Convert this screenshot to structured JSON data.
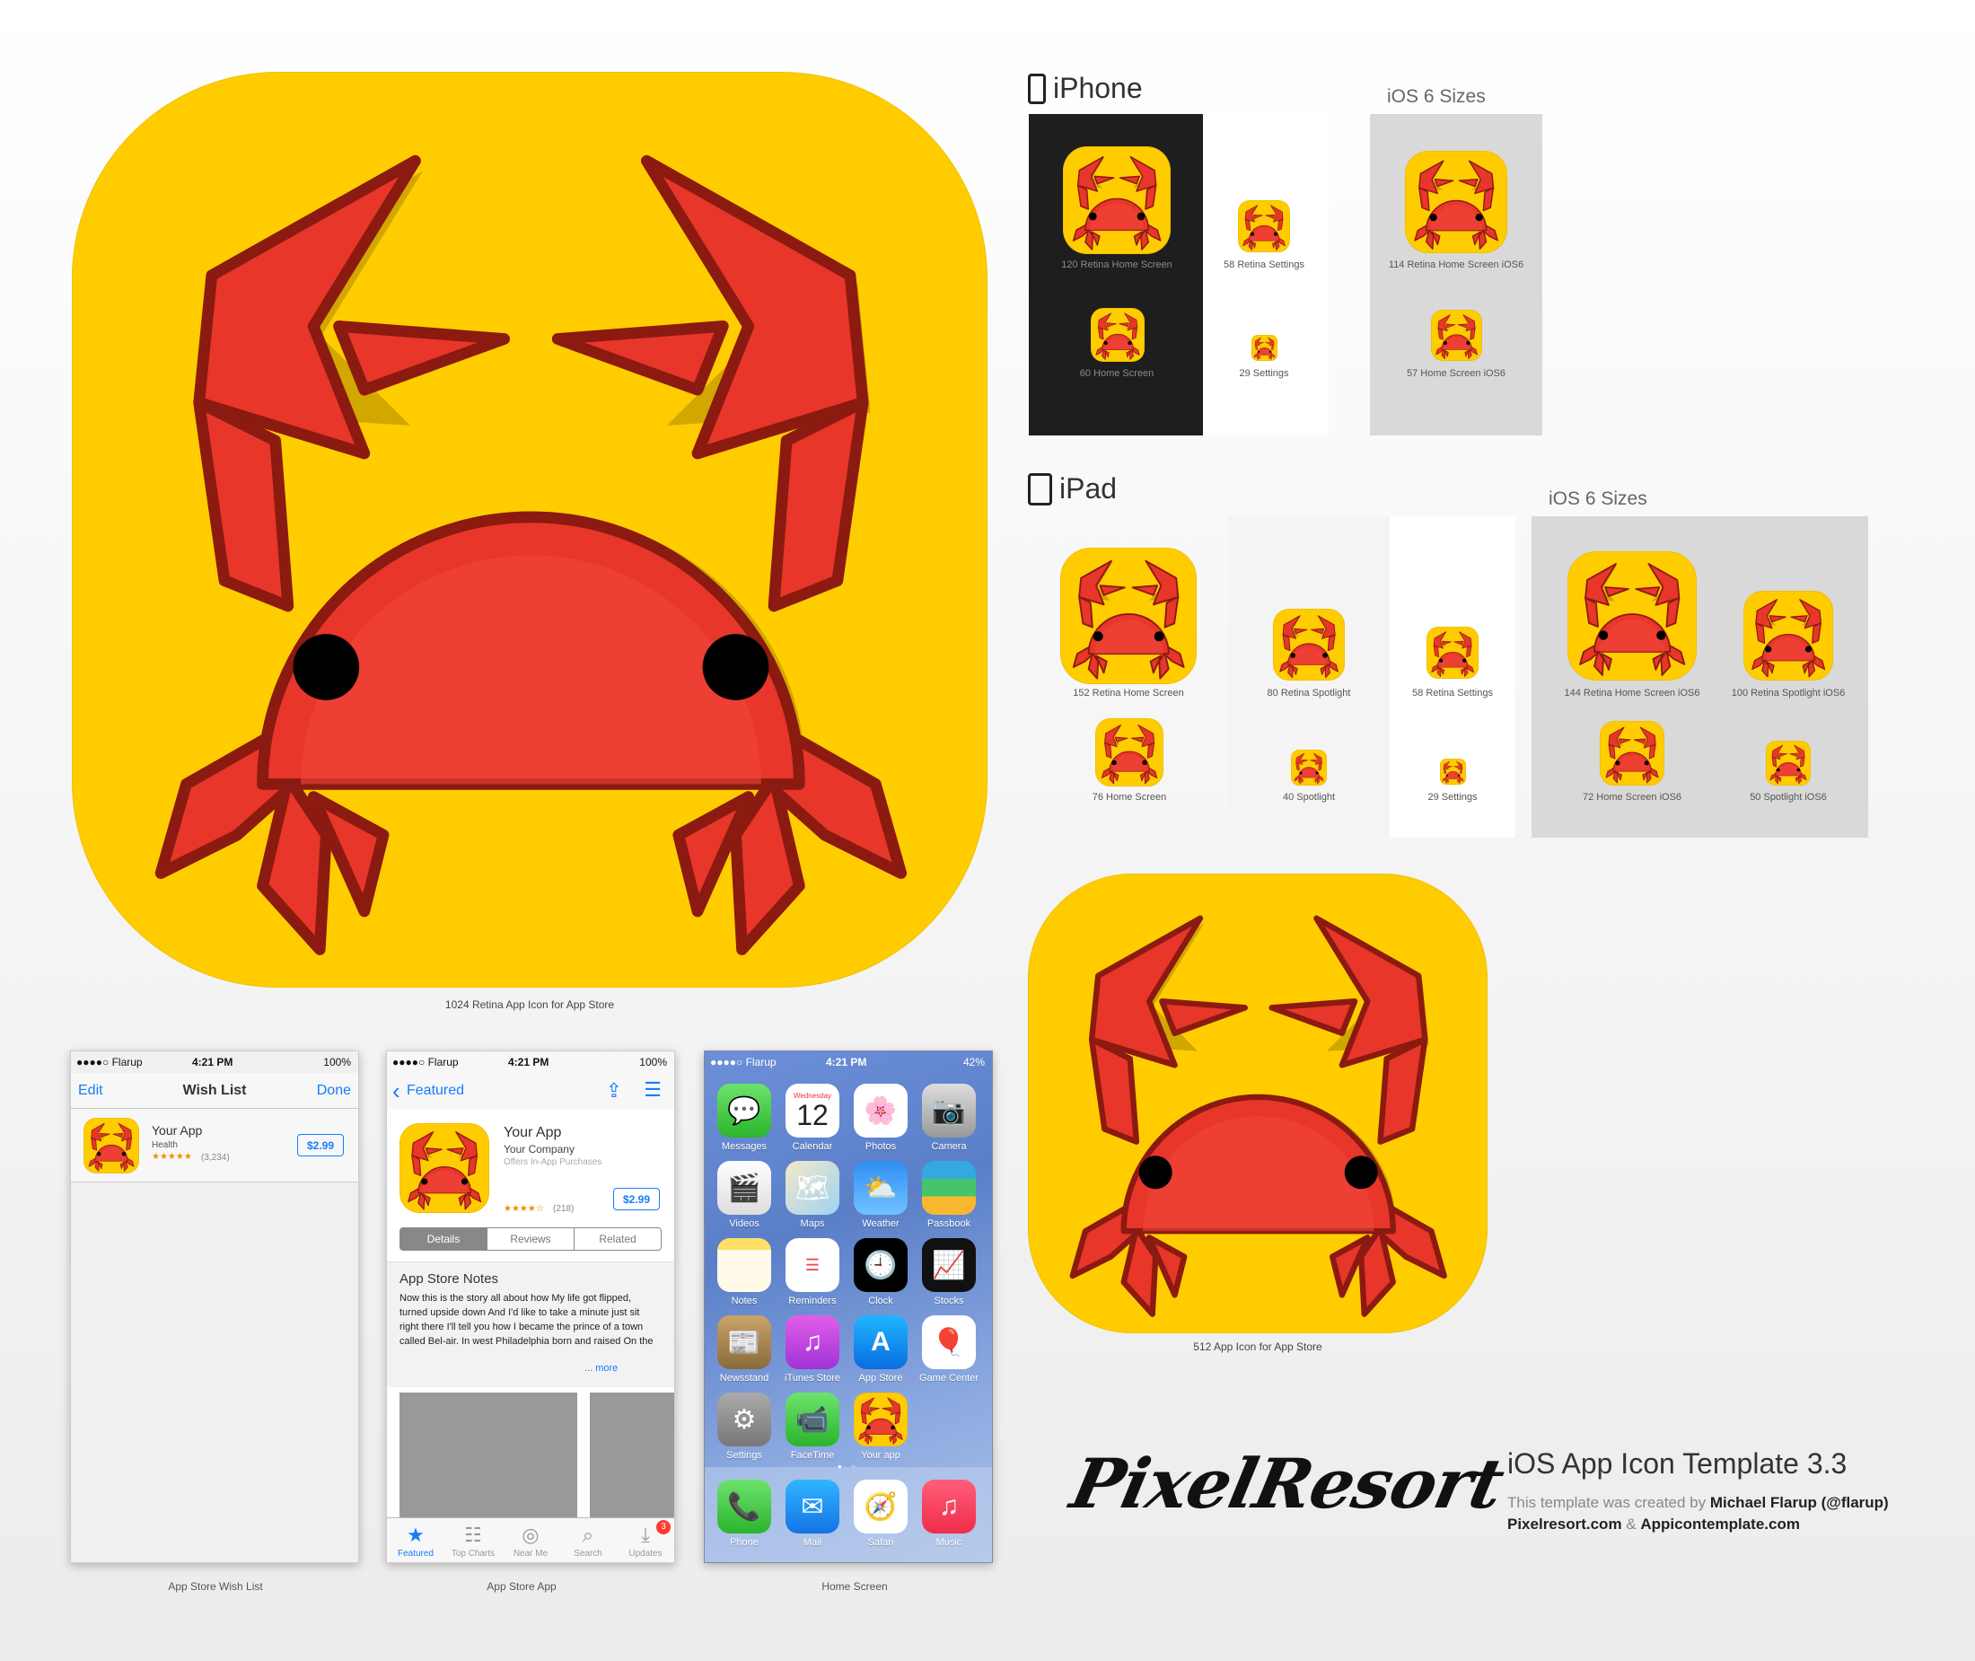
{
  "main_icon": {
    "label": "1024 Retina App Icon for App Store"
  },
  "icon512": {
    "label": "512 App Icon for App Store"
  },
  "iphone": {
    "title": "iPhone",
    "ios6_title": "iOS 6 Sizes",
    "icons": {
      "i120": "120 Retina Home Screen",
      "i58": "58 Retina Settings",
      "i60": "60 Home Screen",
      "i29": "29 Settings",
      "i114": "114 Retina Home Screen iOS6",
      "i57": "57 Home Screen iOS6"
    }
  },
  "ipad": {
    "title": "iPad",
    "ios6_title": "iOS 6 Sizes",
    "icons": {
      "i152": "152 Retina Home Screen",
      "i80": "80 Retina Spotlight",
      "i58": "58 Retina Settings",
      "i76": "76 Home Screen",
      "i40": "40 Spotlight",
      "i29": "29 Settings",
      "i144": "144 Retina Home Screen iOS6",
      "i100": "100 Retina Spotlight iOS6",
      "i72": "72 Home Screen iOS6",
      "i50": "50 Spotlight iOS6"
    }
  },
  "wishlist": {
    "carrier": "●●●●○ Flarup",
    "time": "4:21 PM",
    "battery": "100%",
    "edit": "Edit",
    "title": "Wish List",
    "done": "Done",
    "app_name": "Your App",
    "category": "Health",
    "stars": "★★★★★",
    "rating_count": "(3,234)",
    "price": "$2.99",
    "caption": "App Store Wish List"
  },
  "appstore": {
    "carrier": "●●●●○ Flarup",
    "time": "4:21 PM",
    "battery": "100%",
    "back": "Featured",
    "app_name": "Your App",
    "company": "Your Company",
    "iap": "Offers In-App Purchases",
    "stars": "★★★★☆",
    "rating_count": "(218)",
    "price": "$2.99",
    "seg": [
      "Details",
      "Reviews",
      "Related"
    ],
    "notes_title": "App Store Notes",
    "notes_text": "Now this is the story all about how My life got flipped, turned upside down And I'd like to take a minute just sit right there I'll tell you how I became the prince of a town called Bel-air. In west Philadelphia born and raised On the",
    "more": "... more",
    "tabs": [
      "Featured",
      "Top Charts",
      "Near Me",
      "Search",
      "Updates"
    ],
    "badge": "3",
    "caption": "App Store App"
  },
  "home": {
    "carrier": "●●●●○ Flarup",
    "time": "4:21 PM",
    "battery": "42%",
    "weekday": "Wednesday",
    "day": "12",
    "apps": [
      "Messages",
      "Calendar",
      "Photos",
      "Camera",
      "Videos",
      "Maps",
      "Weather",
      "Passbook",
      "Notes",
      "Reminders",
      "Clock",
      "Stocks",
      "Newsstand",
      "iTunes Store",
      "App Store",
      "Game Center",
      "Settings",
      "FaceTime",
      "Your app"
    ],
    "dock": [
      "Phone",
      "Mail",
      "Safari",
      "Music"
    ],
    "caption": "Home Screen"
  },
  "branding": {
    "logo": "PixelResort",
    "title": "iOS App Icon Template 3.3",
    "created_by": "This template was created by",
    "author": "Michael Flarup (@flarup)",
    "site1": "Pixelresort.com",
    "amp": "&",
    "site2": "Appicontemplate.com"
  },
  "colors": {
    "icon_bg": "#ffcc00",
    "crab_red": "#e8362a",
    "crab_outline": "#8b1a10",
    "ios_blue": "#147efb"
  }
}
